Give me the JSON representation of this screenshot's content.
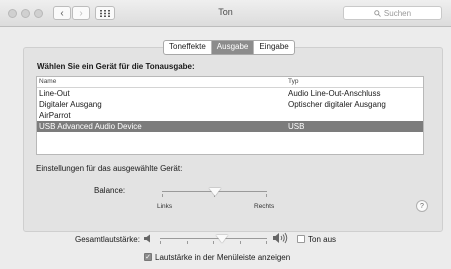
{
  "window": {
    "title": "Ton"
  },
  "search": {
    "placeholder": "Suchen"
  },
  "tabs": [
    {
      "label": "Toneffekte",
      "active": false
    },
    {
      "label": "Ausgabe",
      "active": true
    },
    {
      "label": "Eingabe",
      "active": false
    }
  ],
  "output": {
    "heading": "Wählen Sie ein Gerät für die Tonausgabe:",
    "columns": {
      "name": "Name",
      "type": "Typ"
    },
    "devices": [
      {
        "name": "Line-Out",
        "type": "Audio Line-Out-Anschluss",
        "selected": false
      },
      {
        "name": "Digitaler Ausgang",
        "type": "Optischer digitaler Ausgang",
        "selected": false
      },
      {
        "name": "AirParrot",
        "type": "",
        "selected": false
      },
      {
        "name": "USB Advanced Audio Device",
        "type": "USB",
        "selected": true
      }
    ],
    "settings_label": "Einstellungen für das ausgewählte Gerät:",
    "balance": {
      "label": "Balance:",
      "left": "Links",
      "right": "Rechts",
      "value": 0.5
    }
  },
  "help": {
    "glyph": "?"
  },
  "volume": {
    "label": "Gesamtlautstärke:",
    "level": 0.58,
    "mute_label": "Ton aus",
    "mute_checked": false,
    "menubar_label": "Lautstärke in der Menüleiste anzeigen",
    "menubar_checked": true
  },
  "icons": {
    "back": "chevron-left-icon",
    "forward": "chevron-right-icon",
    "grid": "grid-icon",
    "search": "search-icon",
    "volume_low": "speaker-low-icon",
    "volume_high": "speaker-high-icon"
  }
}
